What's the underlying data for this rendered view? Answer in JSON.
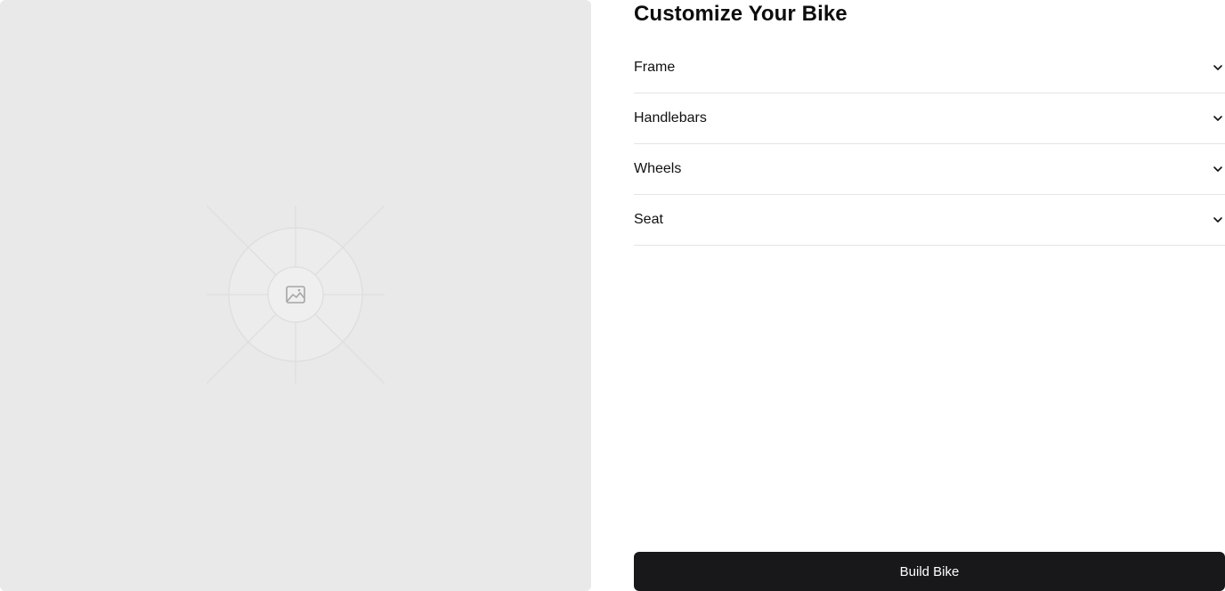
{
  "preview": {
    "image_alt": "image-placeholder-icon",
    "background": "#e9e9e9"
  },
  "panel": {
    "title": "Customize Your Bike",
    "sections": [
      {
        "label": "Frame",
        "icon": "chevron-down-icon"
      },
      {
        "label": "Handlebars",
        "icon": "chevron-down-icon"
      },
      {
        "label": "Wheels",
        "icon": "chevron-down-icon"
      },
      {
        "label": "Seat",
        "icon": "chevron-down-icon"
      }
    ],
    "build_button": "Build Bike"
  },
  "colors": {
    "button_bg": "#18181b",
    "button_text": "#ffffff",
    "divider": "#e4e4e4",
    "preview_bg": "#e9e9e9"
  }
}
